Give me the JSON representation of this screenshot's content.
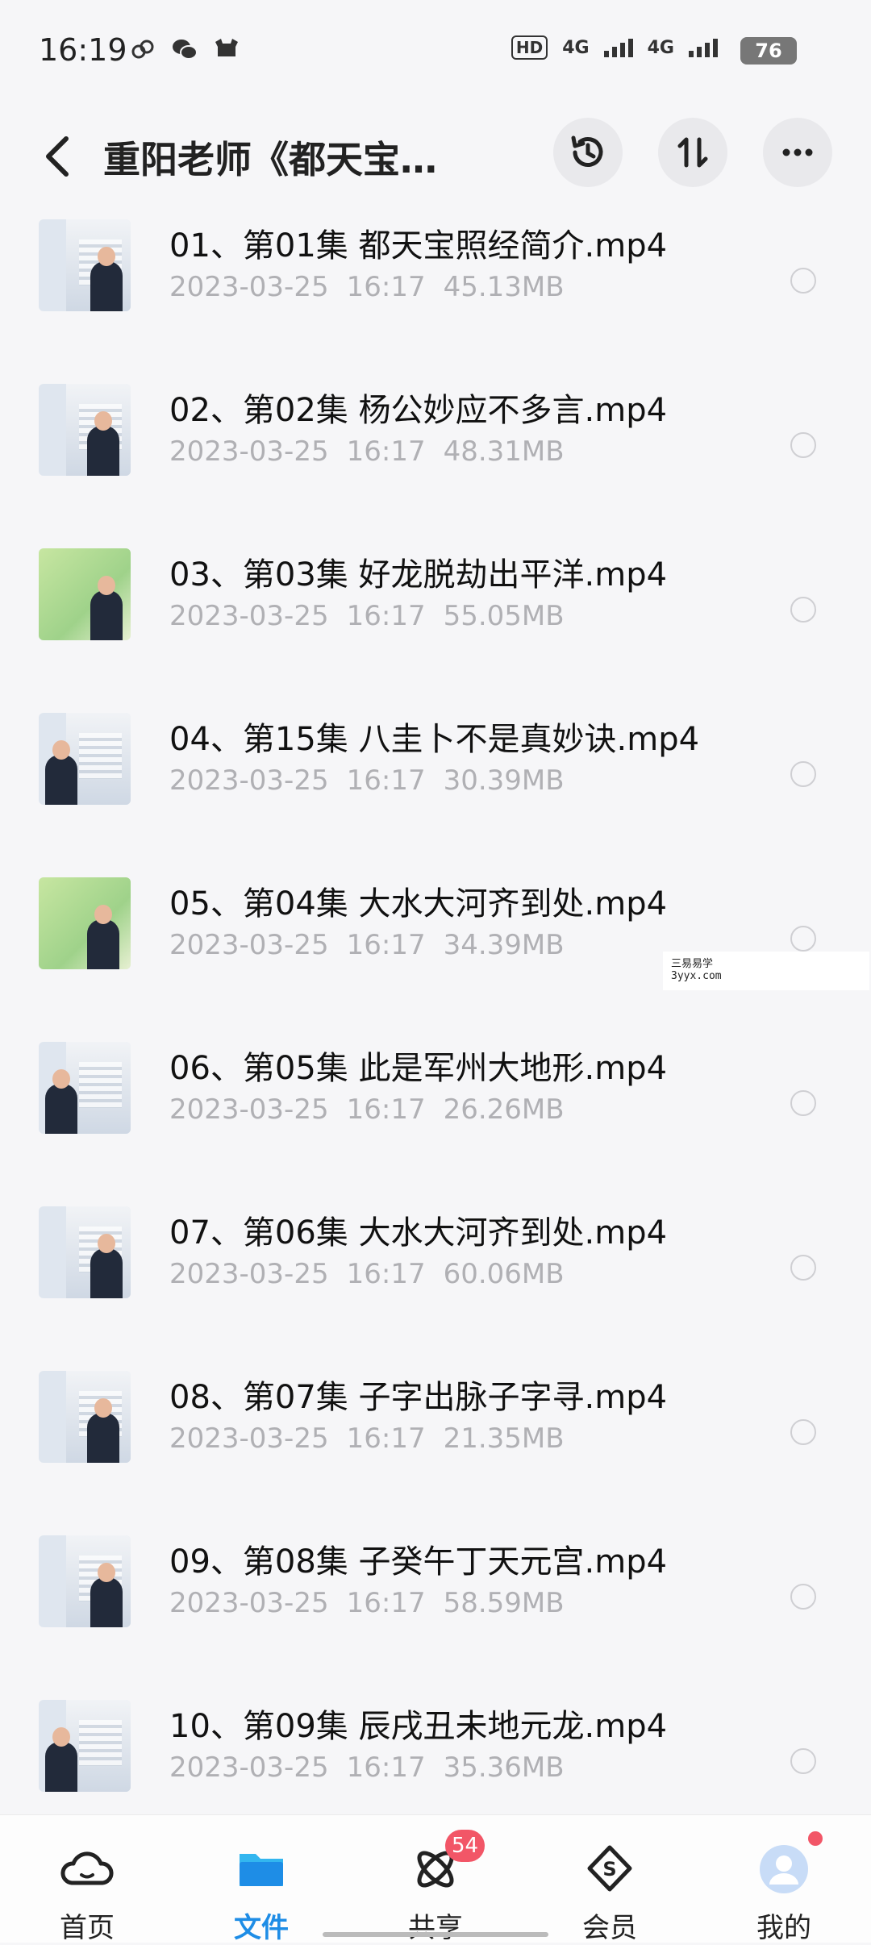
{
  "status_bar": {
    "time": "16:19",
    "hd_label": "HD",
    "net1": "4G",
    "net2": "4G",
    "battery": "76"
  },
  "header": {
    "title": "重阳老师《都天宝…"
  },
  "files": [
    {
      "name": "01、第01集 都天宝照经简介.mp4",
      "date": "2023-03-25",
      "time": "16:17",
      "size": "45.13MB",
      "thumb": "lecture"
    },
    {
      "name": "02、第02集 杨公妙应不多言.mp4",
      "date": "2023-03-25",
      "time": "16:17",
      "size": "48.31MB",
      "thumb": "lecture"
    },
    {
      "name": "03、第03集 好龙脱劫出平洋.mp4",
      "date": "2023-03-25",
      "time": "16:17",
      "size": "55.05MB",
      "thumb": "map"
    },
    {
      "name": "04、第15集 八圭卜不是真妙诀.mp4",
      "date": "2023-03-25",
      "time": "16:17",
      "size": "30.39MB",
      "thumb": "lecture"
    },
    {
      "name": "05、第04集 大水大河齐到处.mp4",
      "date": "2023-03-25",
      "time": "16:17",
      "size": "34.39MB",
      "thumb": "map"
    },
    {
      "name": "06、第05集 此是军州大地形.mp4",
      "date": "2023-03-25",
      "time": "16:17",
      "size": "26.26MB",
      "thumb": "lecture"
    },
    {
      "name": "07、第06集 大水大河齐到处.mp4",
      "date": "2023-03-25",
      "time": "16:17",
      "size": "60.06MB",
      "thumb": "lecture"
    },
    {
      "name": "08、第07集 子字出脉子字寻.mp4",
      "date": "2023-03-25",
      "time": "16:17",
      "size": "21.35MB",
      "thumb": "lecture"
    },
    {
      "name": "09、第08集 子癸午丁天元宫.mp4",
      "date": "2023-03-25",
      "time": "16:17",
      "size": "58.59MB",
      "thumb": "lecture"
    },
    {
      "name": "10、第09集 辰戌丑未地元龙.mp4",
      "date": "2023-03-25",
      "time": "16:17",
      "size": "35.36MB",
      "thumb": "lecture"
    }
  ],
  "watermark": {
    "line1": "三易易学",
    "line2": "3yyx.com"
  },
  "bottom_nav": {
    "home": "首页",
    "files": "文件",
    "share": "共享",
    "share_badge": "54",
    "vip": "会员",
    "mine": "我的",
    "active": "files",
    "active_color": "#1e8de6"
  }
}
